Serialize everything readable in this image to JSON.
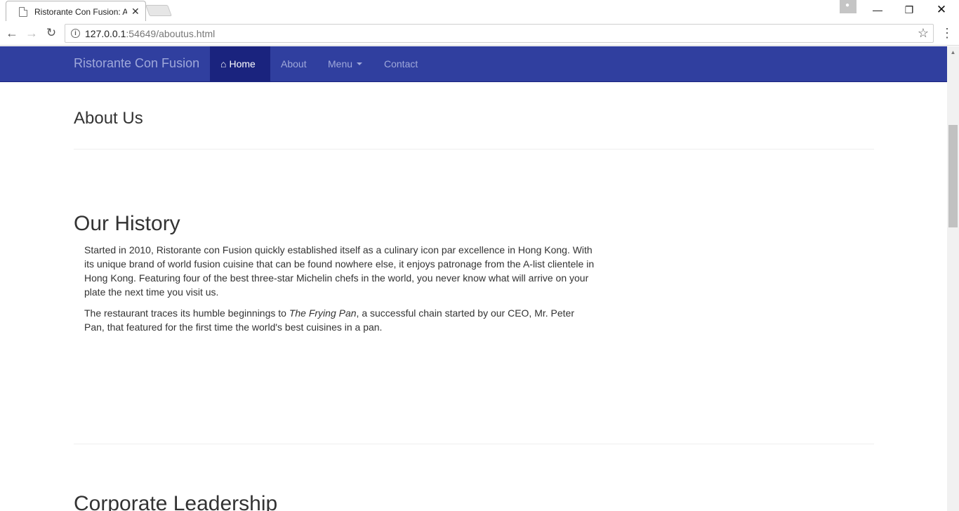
{
  "browser": {
    "tab_title": "Ristorante Con Fusion: About Us",
    "tab_close": "✕",
    "url_host": "127.0.0.1",
    "url_rest": ":54649/aboutus.html",
    "window_min": "—",
    "window_max": "❐",
    "window_close": "✕"
  },
  "navbar": {
    "brand": "Ristorante Con Fusion",
    "items": [
      {
        "label": "Home",
        "active": true
      },
      {
        "label": "About"
      },
      {
        "label": "Menu"
      },
      {
        "label": "Contact"
      }
    ],
    "colors": {
      "background": "#303f9f",
      "active": "#1a237e",
      "text": "#9fa8da"
    }
  },
  "page": {
    "title": "About Us",
    "history_heading": "Our History",
    "history_p1": "Started in 2010, Ristorante con Fusion quickly established itself as a culinary icon par excellence in Hong Kong. With its unique brand of world fusion cuisine that can be found nowhere else, it enjoys patronage from the A-list clientele in Hong Kong. Featuring four of the best three-star Michelin chefs in the world, you never know what will arrive on your plate the next time you visit us.",
    "history_p2_before": "The restaurant traces its humble beginnings to ",
    "history_p2_em": "The Frying Pan",
    "history_p2_after": ", a successful chain started by our CEO, Mr. Peter Pan, that featured for the first time the world's best cuisines in a pan.",
    "leadership_heading": "Corporate Leadership"
  }
}
